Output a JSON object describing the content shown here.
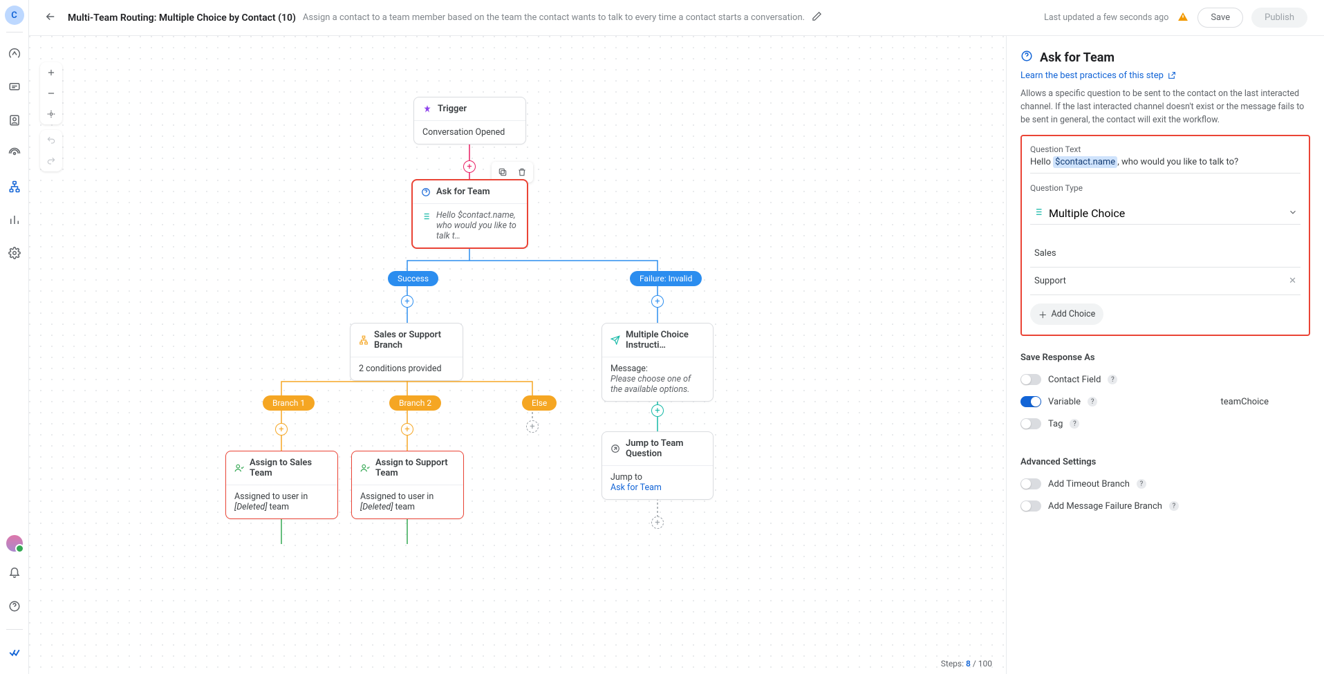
{
  "topbar": {
    "avatar_initial": "C",
    "title": "Multi-Team Routing: Multiple Choice by Contact (10)",
    "description": "Assign a contact to a team member based on the team the contact wants to talk to every time a contact starts a conversation.",
    "last_updated": "Last updated a few seconds ago",
    "save_label": "Save",
    "publish_label": "Publish"
  },
  "canvas": {
    "trigger": {
      "title": "Trigger",
      "body": "Conversation Opened"
    },
    "ask": {
      "title": "Ask for Team",
      "body": "Hello $contact.name, who would you like to talk t…"
    },
    "pills": {
      "success": "Success",
      "failure": "Failure: Invalid",
      "branch1": "Branch 1",
      "branch2": "Branch 2",
      "else": "Else",
      "success_b": "Success"
    },
    "branch": {
      "title": "Sales or Support Branch",
      "body": "2 conditions provided"
    },
    "instructions": {
      "title": "Multiple Choice Instructi…",
      "msg_label": "Message:",
      "msg_body": "Please choose one of the available options."
    },
    "assign_sales": {
      "title": "Assign to Sales Team",
      "body_pre": "Assigned to user in ",
      "deleted": "[Deleted]",
      "body_post": " team"
    },
    "assign_support": {
      "title": "Assign to Support Team",
      "body_pre": "Assigned to user in ",
      "deleted": "[Deleted]",
      "body_post": " team"
    },
    "jump": {
      "title": "Jump to Team Question",
      "label": "Jump to",
      "target": "Ask for Team"
    },
    "steps_label": "Steps: ",
    "steps_cur": "8",
    "steps_sep": " / ",
    "steps_max": "100"
  },
  "panel": {
    "title": "Ask for Team",
    "learn_link": "Learn the best practices of this step",
    "description": "Allows a specific question to be sent to the contact on the last interacted channel. If the last interacted channel doesn't exist or the message fails to be sent in general, the contact will exit the workflow.",
    "question_text_label": "Question Text",
    "question_text_pre": "Hello ",
    "question_text_chip": "$contact.name",
    "question_text_post": ", who would you like to talk to?",
    "question_type_label": "Question Type",
    "question_type_value": "Multiple Choice",
    "choices": {
      "sales": "Sales",
      "support": "Support"
    },
    "add_choice": "Add Choice",
    "save_response_label": "Save Response As",
    "contact_field_label": "Contact Field",
    "variable_label": "Variable",
    "variable_value": "teamChoice",
    "tag_label": "Tag",
    "advanced_label": "Advanced Settings",
    "timeout_label": "Add Timeout Branch",
    "failure_label": "Add Message Failure Branch"
  }
}
